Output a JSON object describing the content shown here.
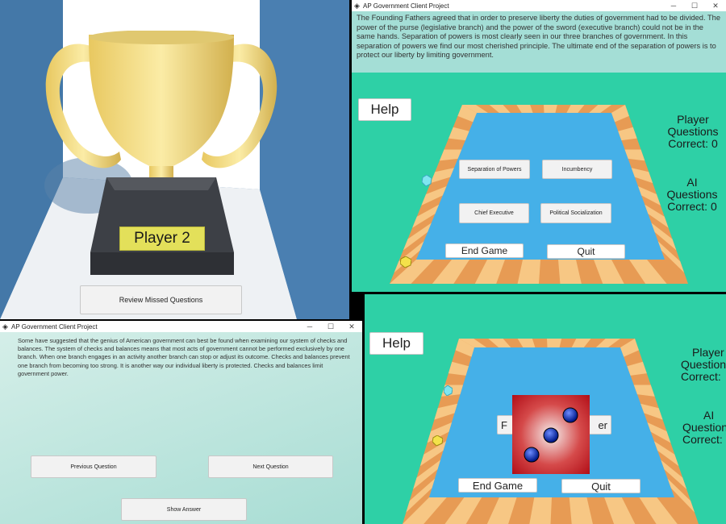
{
  "trophy_scene": {
    "plaque_label": "Player 2",
    "review_button": "Review Missed Questions"
  },
  "window_main": {
    "title": "AP Government Client Project",
    "passage": "The Founding Fathers agreed that in order to preserve liberty the duties of government had to be divided. The power of the purse (legislative branch) and the power of the sword (executive branch) could not be in the same hands. Separation of powers is most clearly seen in our three branches of government. In this separation of powers we find our most cherished principle. The ultimate end of the separation of powers is to protect our liberty by limiting government.",
    "help": "Help",
    "topics": [
      "Separation of Powers",
      "Incumbency",
      "Chief Executive",
      "Political Socialization"
    ],
    "end_game": "End Game",
    "quit": "Quit",
    "player_l1": "Player",
    "player_l2": "Questions",
    "player_l3": "Correct: 0",
    "ai_l1": "AI",
    "ai_l2": "Questions",
    "ai_l3": "Correct: 0"
  },
  "window_review": {
    "title": "AP Government Client Project",
    "text": "Some have suggested that the genius of American government can best be found when examining our system of checks and balances. The system of checks and balances means that most acts of government cannot be performed exclusively by one branch. When one branch engages in an activity another branch can stop or adjust its outcome. Checks and balances prevent one branch from becoming too strong. It is another way our individual liberty is protected. Checks and balances limit government power.",
    "prev": "Previous Question",
    "next": "Next Question",
    "show": "Show Answer"
  },
  "window_dice": {
    "help": "Help",
    "end_game": "End Game",
    "quit": "Quit",
    "player_l1": "Player",
    "player_l2": "Questions",
    "player_l3": "Correct:",
    "ai_l1": "AI",
    "ai_l2": "Questions",
    "ai_l3": "Correct:",
    "hidden_btn_left": "F",
    "hidden_btn_right": "er",
    "die_value": 3
  },
  "colors": {
    "accent_teal": "#2ed0a6",
    "board_blue": "#45b0e8",
    "tile_orange": "#d9793a",
    "tile_light": "#f7c784",
    "die_red": "#c2121e",
    "pip_blue": "#0a2ecc",
    "trophy_gold": "#f0dc82"
  },
  "icons": [
    "unity-logo-icon",
    "minimize-icon",
    "maximize-icon",
    "close-icon",
    "player-token-icon",
    "ai-token-icon",
    "trophy-icon",
    "die-icon"
  ]
}
